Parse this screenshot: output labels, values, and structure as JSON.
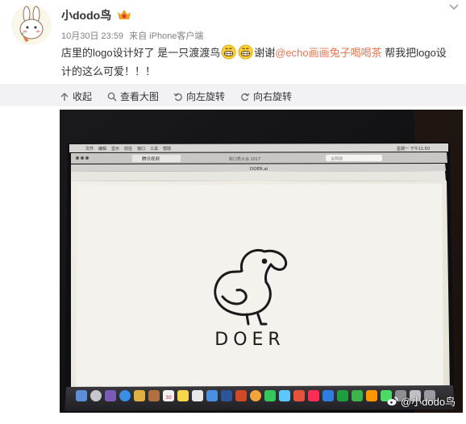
{
  "user": {
    "name": "小dodo鸟"
  },
  "meta": {
    "time": "10月30日 23:59",
    "source": "来自 iPhone客户端"
  },
  "post": {
    "part1": "店里的logo设计好了 是一只渡渡鸟",
    "part2": "谢谢",
    "mention": "@echo画画兔子喝喝茶",
    "part3": " 帮我把logo设计的这么可爱！！！"
  },
  "toolbar": {
    "collapse": "收起",
    "view_large": "查看大图",
    "rotate_left": "向左旋转",
    "rotate_right": "向右旋转"
  },
  "photo": {
    "menubar_items": [
      "文件",
      "编辑",
      "显示",
      "前往",
      "窗口",
      "工具",
      "帮助"
    ],
    "status_text": "星期一 下午11:50",
    "browser_tab": "腾讯视频",
    "browser_tab2": "新口秀大会 2017",
    "search_placeholder": "全网搜",
    "doc_title": "DOER.ai",
    "logo_text": "DOER",
    "dock_calendar_day": "30"
  },
  "watermark": {
    "text": "@小dodo鸟"
  },
  "colors": {
    "mention": "#eb7350",
    "toolbar_bg": "#f2f2f5",
    "text": "#333333",
    "meta": "#808080"
  }
}
